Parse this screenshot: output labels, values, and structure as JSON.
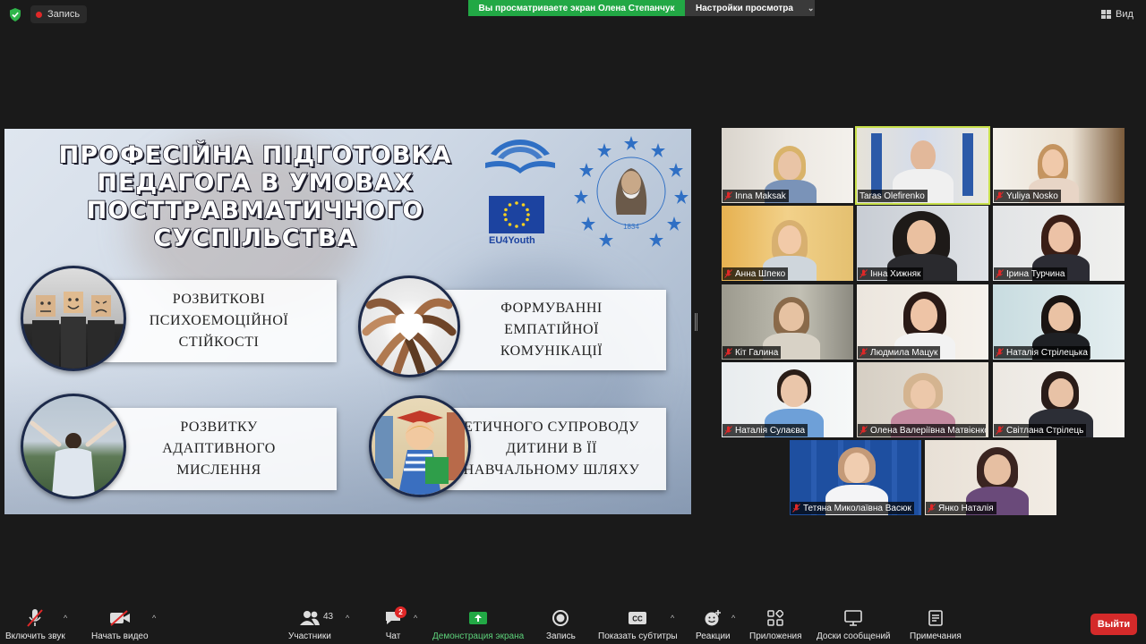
{
  "topbar": {
    "record_label": "Запись",
    "share_banner": "Вы просматриваете экран Олена Степанчук",
    "view_settings_label": "Настройки просмотра",
    "view_label": "Вид"
  },
  "slide": {
    "title_lines": [
      "ПРОФЕСІЙНА ПІДГОТОВКА",
      "ПЕДАГОГА В УМОВАХ",
      "ПОСТТРАВМАТИЧНОГО",
      "СУСПІЛЬСТВА"
    ],
    "eu_label": "EU4Youth",
    "emblem_text": "Український державний університет імені Михайла Драгоманова",
    "emblem_year": "1834",
    "cards": [
      {
        "text": "РОЗВИТКОВІ\nПСИХОЕМОЦІЙНОЇ\nСТІЙКОСТІ"
      },
      {
        "text": "ФОРМУВАННІ\nЕМПАТІЙНОЇ\nКОМУНІКАЦІЇ"
      },
      {
        "text": "РОЗВИТКУ\nАДАПТИВНОГО\nМИСЛЕННЯ"
      },
      {
        "text": "ЕТИЧНОГО СУПРОВОДУ\nДИТИНИ В ЇЇ\nНАВЧАЛЬНОМУ ШЛЯХУ"
      }
    ]
  },
  "participants": [
    {
      "name": "Inna Maksak",
      "active": false
    },
    {
      "name": "Taras Olefirenko",
      "active": true
    },
    {
      "name": "Yuliya Nosko",
      "active": false
    },
    {
      "name": "Анна Шпеко",
      "active": false
    },
    {
      "name": "Інна Хижняк",
      "active": false
    },
    {
      "name": "Ірина Турчина",
      "active": false
    },
    {
      "name": "Кіт Галина",
      "active": false
    },
    {
      "name": "Людмила Мацук",
      "active": false
    },
    {
      "name": "Наталія Стрілецька",
      "active": false
    },
    {
      "name": "Наталія Сулаєва",
      "active": false
    },
    {
      "name": "Олена Валеріївна Матвієнко",
      "active": false
    },
    {
      "name": "Світлана Стрілець",
      "active": false
    },
    {
      "name": "Тетяна Миколаївна Васюк",
      "active": false
    },
    {
      "name": "Янко Наталія",
      "active": false
    }
  ],
  "toolbar": {
    "audio_label": "Включить звук",
    "video_label": "Начать видео",
    "participants_label": "Участники",
    "participants_count": "43",
    "chat_label": "Чат",
    "chat_badge": "2",
    "share_label": "Демонстрация экрана",
    "record_label": "Запись",
    "captions_label": "Показать субтитры",
    "captions_icon_text": "CC",
    "reactions_label": "Реакции",
    "apps_label": "Приложения",
    "whiteboards_label": "Доски сообщений",
    "notes_label": "Примечания",
    "exit_label": "Выйти"
  },
  "colors": {
    "share_green": "#22a845",
    "exit_red": "#d42a2a",
    "active_speaker": "#c8e04a",
    "muted_red": "#e02828"
  }
}
